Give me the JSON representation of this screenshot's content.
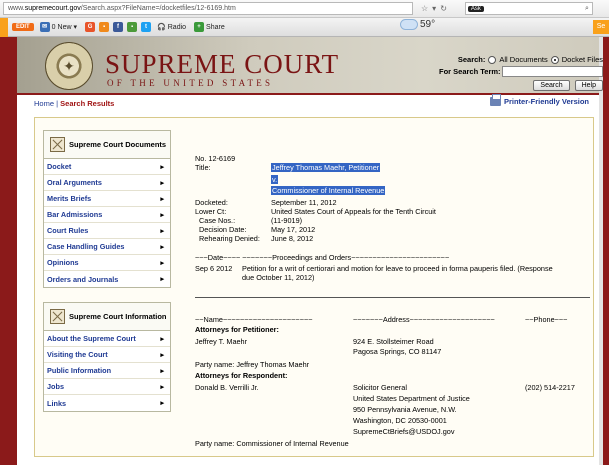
{
  "browser": {
    "url_prefix": "www.",
    "url_domain": "supremecourt.gov",
    "url_path": "/Search.aspx?FileName=/docketfiles/12-6169.htm",
    "search_badge": "Ask",
    "weather_temp": "59°"
  },
  "toolbar": {
    "edit_label": "EDIT",
    "mail_label": "0 New",
    "radio_label": "Radio",
    "share_label": "Share"
  },
  "header": {
    "title": "SUPREME COURT",
    "subtitle": "OF THE UNITED STATES",
    "search_label": "Search:",
    "opt_all": "All Documents",
    "opt_docket": "Docket Files",
    "search_term_label": "For Search Term:",
    "search_button": "Search",
    "help_button": "Help"
  },
  "breadcrumb": {
    "home": "Home",
    "sep": " | ",
    "current": "Search Results"
  },
  "print_label": "Printer-Friendly Version",
  "sidebar": {
    "documents_title": "Supreme Court Documents",
    "documents": [
      "Docket",
      "Oral Arguments",
      "Merits Briefs",
      "Bar Admissions",
      "Court Rules",
      "Case Handling Guides",
      "Opinions",
      "Orders and Journals"
    ],
    "info_title": "Supreme Court Information",
    "info": [
      "About the Supreme Court",
      "Visiting the Court",
      "Public Information",
      "Jobs",
      "Links"
    ]
  },
  "docket": {
    "number": "No. 12-6169",
    "title_label": "Title:",
    "title_line1": "Jeffrey Thomas Maehr, Petitioner",
    "title_line2": "v.",
    "title_line3": "Commissioner of Internal Revenue",
    "docketed_label": "Docketed:",
    "docketed": "September 11, 2012",
    "lower_label": "Lower Ct:",
    "lower": "United States Court of Appeals for the Tenth Circuit",
    "case_label": "Case Nos.:",
    "case": "(11-9019)",
    "decision_label": "Decision Date:",
    "decision": "May 17, 2012",
    "rehearing_label": "Rehearing Denied:",
    "rehearing": "June 8, 2012",
    "proc_header": "~~~Date~~~~ ~~~~~~~Proceedings and Orders~~~~~~~~~~~~~~~~~~~~~~~",
    "proc_date": "Sep 6 2012",
    "proc_text1": "Petition for a writ of certiorari and motion for leave to proceed in forma pauperis filed. (Response",
    "proc_text2": "due October 11, 2012)",
    "name_header": "~~Name~~~~~~~~~~~~~~~~~~~~~",
    "address_header": "~~~~~~~Address~~~~~~~~~~~~~~~~~~~~",
    "phone_header": "~~Phone~~~",
    "pet_heading": "Attorneys for Petitioner:",
    "pet_name": "Jeffrey T. Maehr",
    "pet_addr1": "924 E. Stollsteimer Road",
    "pet_addr2": "Pagosa Springs, CO 81147",
    "pet_party": "Party name: Jeffrey Thomas Maehr",
    "resp_heading": "Attorneys for Respondent:",
    "resp_name": "Donald B. Verrilli Jr.",
    "resp_addr1": "Solicitor General",
    "resp_addr2": "United States Department of Justice",
    "resp_addr3": "950 Pennsylvania Avenue, N.W.",
    "resp_addr4": "Washington, DC 20530-0001",
    "resp_addr5": "SupremeCtBriefs@USDOJ.gov",
    "resp_phone": "(202) 514-2217",
    "resp_party": "Party name: Commissioner of Internal Revenue"
  }
}
